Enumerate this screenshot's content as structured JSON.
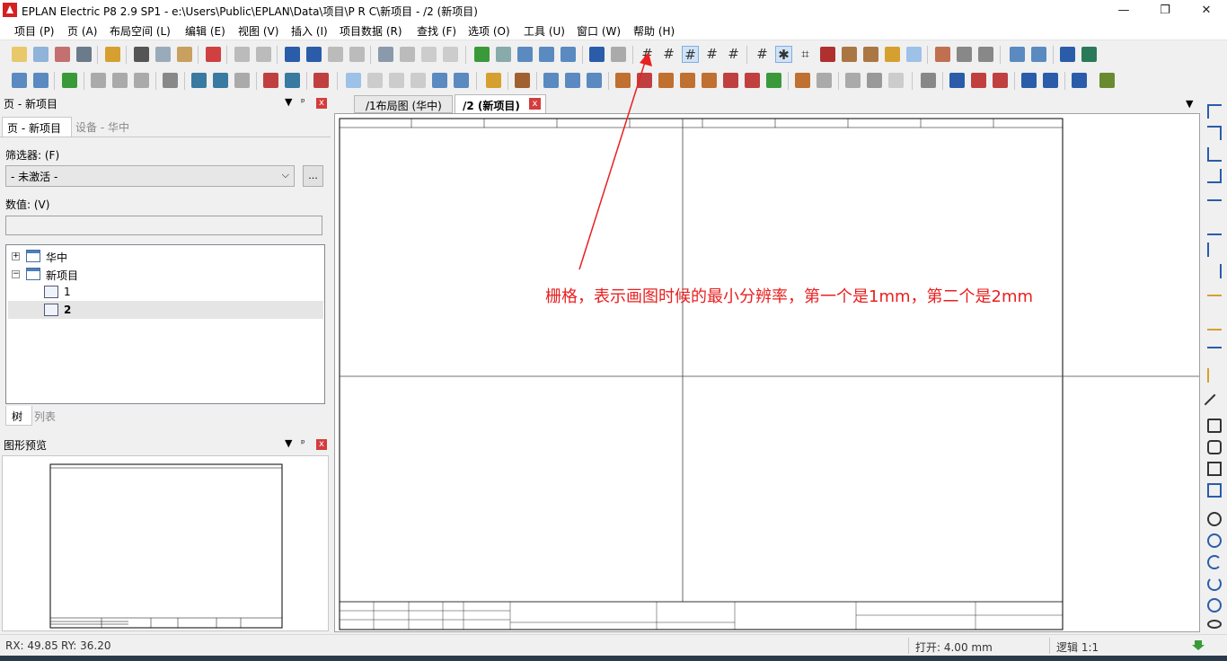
{
  "window": {
    "title": "EPLAN Electric P8 2.9 SP1 - e:\\Users\\Public\\EPLAN\\Data\\项目\\P R C\\新项目 - /2 (新项目)",
    "minimize": "—",
    "maximize": "❐",
    "close": "✕"
  },
  "menubar": {
    "items": [
      "项目 (P)",
      "页 (A)",
      "布局空间 (L)",
      "编辑 (E)",
      "视图 (V)",
      "插入 (I)",
      "项目数据 (R)",
      "查找 (F)",
      "选项 (O)",
      "工具 (U)",
      "窗口 (W)",
      "帮助 (H)"
    ]
  },
  "toolbar": {
    "grid_buttons": [
      "grid-a-icon",
      "grid-b-icon",
      "grid-c-icon",
      "grid-d-icon",
      "grid-e-icon"
    ]
  },
  "page_panel": {
    "title": "页 - 新项目",
    "pin": "ᵖ",
    "dropdown": "▼",
    "close": "x",
    "tabs": [
      "页 - 新项目",
      "设备 - 华中"
    ],
    "filter_label": "筛选器: (F)",
    "filter_value": "- 未激活 -",
    "filter_button": "...",
    "value_label": "数值: (V)",
    "value_input": "",
    "tree": {
      "items": [
        {
          "label": "华中",
          "expander": "+"
        },
        {
          "label": "新项目",
          "expander": "−"
        },
        {
          "label": "1"
        },
        {
          "label": "2"
        }
      ]
    },
    "bottom_tabs": [
      "树",
      "列表"
    ]
  },
  "preview_panel": {
    "title": "图形预览",
    "close": "x"
  },
  "document_tabs": [
    "/1布局图 (华中)",
    "/2 (新项目)"
  ],
  "annotation": {
    "text": "栅格，表示画图时候的最小分辨率，第一个是1mm，第二个是2mm",
    "color": "#e82020"
  },
  "statusbar": {
    "rx": "RX: 49.85",
    "ry": "RY: 36.20",
    "open": "打开: 4.00 mm",
    "logic": "逻辑 1:1"
  },
  "colors": {
    "accent": "#84acdd",
    "annotation": "#e82020",
    "close_red": "#d43d3d"
  }
}
